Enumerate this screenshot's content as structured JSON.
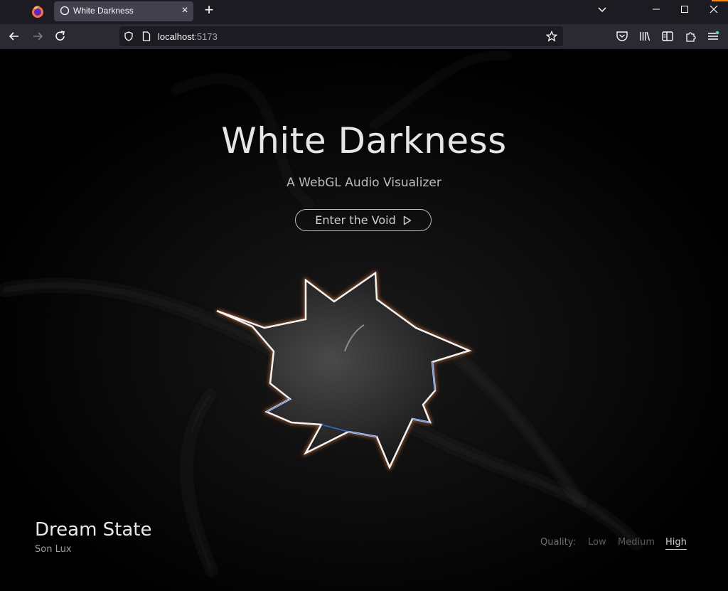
{
  "browser": {
    "tab_title": "White Darkness",
    "url_host": "localhost",
    "url_port": ":5173"
  },
  "hero": {
    "title": "White Darkness",
    "subtitle": "A WebGL Audio Visualizer",
    "cta_label": "Enter the Void"
  },
  "track": {
    "title": "Dream State",
    "artist": "Son Lux"
  },
  "quality": {
    "label": "Quality:",
    "options": [
      "Low",
      "Medium",
      "High"
    ],
    "selected": "High"
  },
  "colors": {
    "chrome_dark": "#1c1b22",
    "chrome_toolbar": "#2b2a33",
    "tab_active": "#42414d",
    "page_bg": "#000000",
    "text_primary": "#e6e6e6"
  },
  "icons": {
    "app": "firefox-icon",
    "tab": "globe-icon",
    "back": "arrow-left-icon",
    "forward": "arrow-right-icon",
    "reload": "reload-icon",
    "shield": "shield-icon",
    "page": "page-icon",
    "bookmark": "star-icon",
    "pocket": "pocket-icon",
    "library": "library-icon",
    "sidebar": "sidebar-icon",
    "extensions": "puzzle-icon",
    "menu": "hamburger-menu-icon",
    "play": "play-icon"
  }
}
